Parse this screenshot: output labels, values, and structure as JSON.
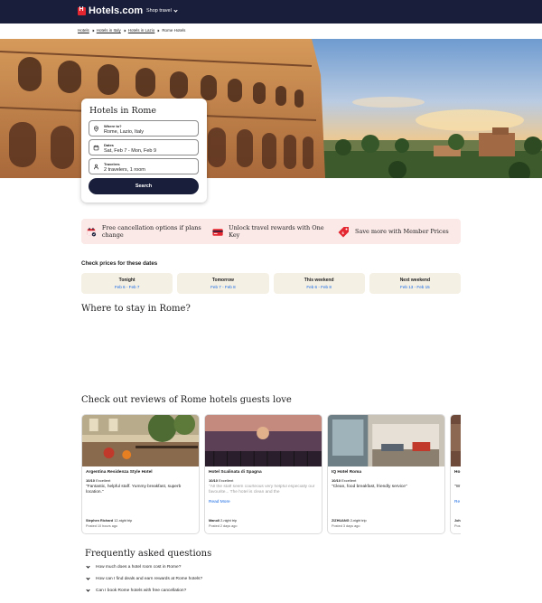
{
  "header": {
    "brand": "Hotels.com",
    "shop_travel": "Shop travel"
  },
  "breadcrumb": [
    "Hotels",
    "Hotels in Italy",
    "Hotels in Lazio",
    "Rome Hotels"
  ],
  "search": {
    "title": "Hotels in Rome",
    "where_label": "Where to?",
    "where_value": "Rome, Lazio, Italy",
    "dates_label": "Dates",
    "dates_value": "Sat, Feb 7 - Mon, Feb 9",
    "travelers_label": "Travelers",
    "travelers_value": "2 travelers, 1 room",
    "button": "Search"
  },
  "benefits": [
    {
      "icon": "calendar-icon",
      "text": "Free cancellation options if plans change"
    },
    {
      "icon": "credit-card-icon",
      "text": "Unlock travel rewards with One Key"
    },
    {
      "icon": "price-tag-icon",
      "text": "Save more with Member Prices"
    }
  ],
  "dates_section": {
    "title": "Check prices for these dates",
    "options": [
      {
        "label": "Tonight",
        "range": "Feb 6 - Feb 7"
      },
      {
        "label": "Tomorrow",
        "range": "Feb 7 - Feb 8"
      },
      {
        "label": "This weekend",
        "range": "Feb 6 - Feb 8"
      },
      {
        "label": "Next weekend",
        "range": "Feb 13 - Feb 15"
      }
    ]
  },
  "where_to_stay": {
    "title": "Where to stay in Rome?"
  },
  "reviews": {
    "title": "Check out reviews of Rome hotels guests love",
    "items": [
      {
        "hotel": "Argentina Residenza Style Hotel",
        "score": "10/10",
        "rating_word": "Excellent",
        "quote": "\"Fantastic, helpful staff. Yummy breakfast, superb location.\"",
        "author": "Stephen Richard",
        "trip": "12-night trip",
        "posted": "Posted 10 hours ago"
      },
      {
        "hotel": "Hotel Scalinata di Spagna",
        "score": "10/10",
        "rating_word": "Excellent",
        "quote": "\"All the staff seem courteous very helpful especially our favourite... The hotel is clean and the",
        "more": "Read More",
        "author": "Manoli",
        "trip": "2-night trip",
        "posted": "Posted 2 days ago"
      },
      {
        "hotel": "IQ Hotel Roma",
        "score": "10/10",
        "rating_word": "Excellent",
        "quote": "\"Clean, food breakfast, friendly service\"",
        "author": "ZIZHUANG",
        "trip": "2-night trip",
        "posted": "Posted 3 days ago"
      },
      {
        "hotel": "Ho",
        "quote": "\"W",
        "more": "Re",
        "author": "Joh",
        "posted": "Pos"
      }
    ]
  },
  "faq": {
    "title": "Frequently asked questions",
    "items": [
      "How much does a hotel room cost in Rome?",
      "How can I find deals and earn rewards at Rome hotels?",
      "Can I book Rome hotels with free cancellation?"
    ]
  },
  "colors": {
    "header_bg": "#191e3b",
    "brand_red": "#e3262f",
    "link_blue": "#1668e3",
    "benefit_bg": "#fbe9e7",
    "date_card_bg": "#f5f0e4"
  }
}
